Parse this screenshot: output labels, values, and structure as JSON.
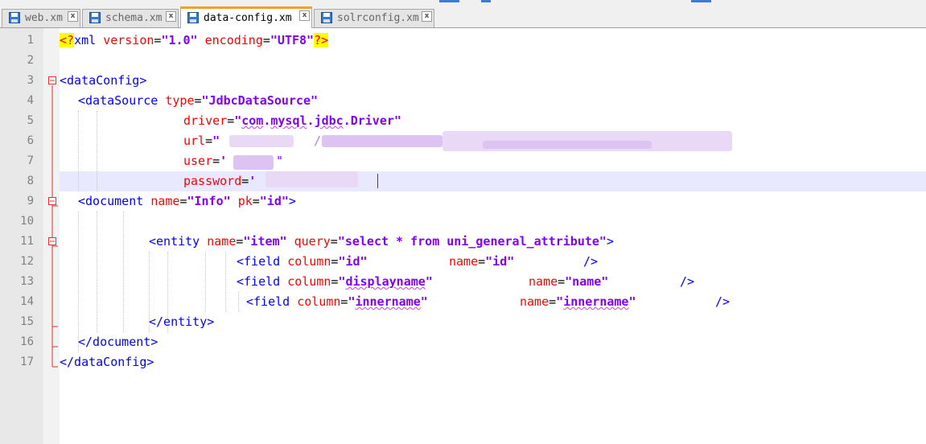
{
  "tabs": [
    {
      "label": "web.xm",
      "active": false,
      "icon": "floppy-disk-icon"
    },
    {
      "label": "schema.xm",
      "active": false,
      "icon": "floppy-disk-icon"
    },
    {
      "label": "data-config.xm",
      "active": true,
      "icon": "floppy-disk-icon"
    },
    {
      "label": "solrconfig.xm",
      "active": false,
      "icon": "floppy-disk-icon"
    }
  ],
  "tab_close_glyph": "x",
  "line_numbers": [
    "1",
    "2",
    "3",
    "4",
    "5",
    "6",
    "7",
    "8",
    "9",
    "10",
    "11",
    "12",
    "13",
    "14",
    "15",
    "16",
    "17"
  ],
  "code": {
    "l1": {
      "open": "<?",
      "name": "xml",
      "a1": "version",
      "eq": "=",
      "v1": "\"1.0\"",
      "a2": "encoding",
      "v2": "\"UTF8\"",
      "close": "?>"
    },
    "l3": {
      "text": "<dataConfig>"
    },
    "l4": {
      "open": "<dataSource",
      "attr": "type",
      "eq": "=",
      "val": "\"JdbcDataSource\""
    },
    "l5": {
      "attr": "driver",
      "eq": "=",
      "q1": "\"",
      "v_a": "com",
      "dot1": ".",
      "v_b": "mysql",
      "dot2": ".",
      "v_c": "jdbc",
      "dot3": ".",
      "v_d": "Driver",
      "q2": "\""
    },
    "l6": {
      "attr": "url",
      "eq": "=",
      "val_visible": "\"",
      "val_visible2": "/"
    },
    "l7": {
      "attr": "user",
      "eq": "=",
      "val_visible": "'",
      "val_visible2": "\""
    },
    "l8": {
      "attr": "password",
      "eq": "=",
      "val_visible": "'"
    },
    "l9": {
      "open": "<document",
      "a1": "name",
      "eq": "=",
      "v1": "\"Info\"",
      "a2": "pk",
      "v2": "\"id\"",
      "close": ">"
    },
    "l11": {
      "open": "<entity",
      "a1": "name",
      "eq": "=",
      "v1": "\"item\"",
      "a2": "query",
      "v2": "\"select * from uni_general_attribute\"",
      "close": ">"
    },
    "l12": {
      "open": "<field",
      "a1": "column",
      "eq": "=",
      "v1": "\"id\"",
      "a2": "name",
      "v2": "\"id\"",
      "close": "/>"
    },
    "l13": {
      "open": "<field",
      "a1": "column",
      "eq": "=",
      "q1": "\"",
      "v1": "displayname",
      "q1b": "\"",
      "a2": "name",
      "v2": "\"name\"",
      "close": "/>"
    },
    "l14": {
      "open": "<field",
      "a1": "column",
      "eq": "=",
      "q1": "\"",
      "v1": "innername",
      "q1b": "\"",
      "a2": "name",
      "q2": "\"",
      "v2": "innername",
      "q2b": "\"",
      "close": "/>"
    },
    "l15": {
      "text": "</entity>"
    },
    "l16": {
      "text": "</document>"
    },
    "l17": {
      "text": "</dataConfig>"
    }
  },
  "colors": {
    "tag": "#0000ff",
    "attr": "#ff0000",
    "value": "#8000ff",
    "active_tab_accent": "#f0a030",
    "current_line": "#e8e8ff"
  },
  "current_line_number": 8
}
